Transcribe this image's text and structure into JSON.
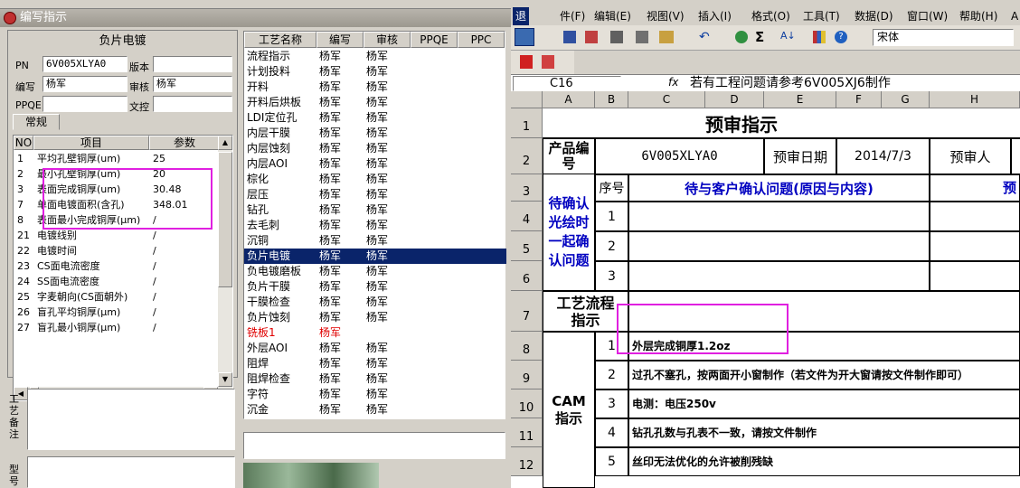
{
  "left_window": {
    "title": "编写指示"
  },
  "product_panel": {
    "header": "负片电镀",
    "pn_label": "PN",
    "pn_value": "6V005XLYA0",
    "version_label": "版本",
    "version_value": "",
    "writer_label": "编写",
    "writer_value": "杨军",
    "reviewer_label": "审核",
    "reviewer_value": "杨军",
    "ppqe_label": "PPQE",
    "ppqe_value": "",
    "doc_hole_label": "文控",
    "doc_hole_value": "",
    "tab_general": "常规"
  },
  "param_grid": {
    "headers": [
      "NO",
      "项目",
      "参数"
    ],
    "rows": [
      {
        "no": "1",
        "item": "平均孔壁铜厚(um)",
        "value": "25"
      },
      {
        "no": "2",
        "item": "最小孔壁铜厚(um)",
        "value": "20"
      },
      {
        "no": "3",
        "item": "表面完成铜厚(um)",
        "value": "30.48"
      },
      {
        "no": "7",
        "item": "单面电镀面积(含孔)",
        "value": "348.01"
      },
      {
        "no": "8",
        "item": "表面最小完成铜厚(μm)",
        "value": "/"
      },
      {
        "no": "21",
        "item": "电镀线别",
        "value": "/"
      },
      {
        "no": "22",
        "item": "电镀时间",
        "value": "/"
      },
      {
        "no": "23",
        "item": "CS面电流密度",
        "value": "/"
      },
      {
        "no": "24",
        "item": "SS面电流密度",
        "value": "/"
      },
      {
        "no": "25",
        "item": "字麦朝向(CS面朝外)",
        "value": "/"
      },
      {
        "no": "26",
        "item": "盲孔平均铜厚(μm)",
        "value": "/"
      },
      {
        "no": "27",
        "item": "盲孔最小铜厚(μm)",
        "value": "/"
      }
    ]
  },
  "notes": {
    "label1": "工艺备注",
    "label2": "型号"
  },
  "process_grid": {
    "headers": [
      "工艺名称",
      "编写",
      "审核",
      "PPQE",
      "PPC"
    ],
    "rows": [
      {
        "name": "流程指示",
        "writer": "杨军",
        "reviewer": "杨军"
      },
      {
        "name": "计划投料",
        "writer": "杨军",
        "reviewer": "杨军"
      },
      {
        "name": "开料",
        "writer": "杨军",
        "reviewer": "杨军"
      },
      {
        "name": "开料后烘板",
        "writer": "杨军",
        "reviewer": "杨军"
      },
      {
        "name": "LDI定位孔",
        "writer": "杨军",
        "reviewer": "杨军"
      },
      {
        "name": "内层干膜",
        "writer": "杨军",
        "reviewer": "杨军"
      },
      {
        "name": "内层蚀刻",
        "writer": "杨军",
        "reviewer": "杨军"
      },
      {
        "name": "内层AOI",
        "writer": "杨军",
        "reviewer": "杨军"
      },
      {
        "name": "棕化",
        "writer": "杨军",
        "reviewer": "杨军"
      },
      {
        "name": "层压",
        "writer": "杨军",
        "reviewer": "杨军"
      },
      {
        "name": "钻孔",
        "writer": "杨军",
        "reviewer": "杨军"
      },
      {
        "name": "去毛刺",
        "writer": "杨军",
        "reviewer": "杨军"
      },
      {
        "name": "沉铜",
        "writer": "杨军",
        "reviewer": "杨军"
      },
      {
        "name": "负片电镀",
        "writer": "杨军",
        "reviewer": "杨军"
      },
      {
        "name": "负电镀磨板",
        "writer": "杨军",
        "reviewer": "杨军"
      },
      {
        "name": "负片干膜",
        "writer": "杨军",
        "reviewer": "杨军"
      },
      {
        "name": "干膜检查",
        "writer": "杨军",
        "reviewer": "杨军"
      },
      {
        "name": "负片蚀刻",
        "writer": "杨军",
        "reviewer": "杨军"
      },
      {
        "name": "铣板1",
        "writer": "杨军",
        "reviewer": ""
      },
      {
        "name": "外层AOI",
        "writer": "杨军",
        "reviewer": "杨军"
      },
      {
        "name": "阻焊",
        "writer": "杨军",
        "reviewer": "杨军"
      },
      {
        "name": "阻焊检查",
        "writer": "杨军",
        "reviewer": "杨军"
      },
      {
        "name": "字符",
        "writer": "杨军",
        "reviewer": "杨军"
      },
      {
        "name": "沉金",
        "writer": "杨军",
        "reviewer": "杨军"
      }
    ]
  },
  "excel": {
    "menu": [
      "退",
      "件(F)",
      "编辑(E)",
      "视图(V)",
      "插入(I)",
      "格式(O)",
      "工具(T)",
      "数据(D)",
      "窗口(W)",
      "帮助(H)",
      "A"
    ],
    "font_name": "宋体",
    "cell_ref": "C16",
    "fx": "fx",
    "formula": "若有工程问题请参考6V005XJ6制作",
    "columns": [
      "A",
      "B",
      "C",
      "D",
      "E",
      "F",
      "G",
      "H"
    ],
    "row_numbers": [
      "1",
      "2",
      "3",
      "4",
      "5",
      "6",
      "7",
      "8",
      "9",
      "10",
      "11",
      "12"
    ],
    "title": "预审指示",
    "product_label": "产品编号",
    "product_no": "6V005XLYA0",
    "review_date_label": "预审日期",
    "review_date": "2014/7/3",
    "reviewer_label": "预审人",
    "seq_label": "序号",
    "issues_label": "待与客户确认问题(原因与内容)",
    "pre_label": "预",
    "pending_label": "待确认光绘时一起确认问题",
    "pending_rows": [
      "1",
      "2",
      "3"
    ],
    "process_label": "工艺流程指示",
    "cam_label": "CAM指示",
    "cam_items": [
      {
        "no": "1",
        "text": "外层完成铜厚1.2oz"
      },
      {
        "no": "2",
        "text": "过孔不塞孔，按两面开小窗制作（若文件为开大窗请按文件制作即可）"
      },
      {
        "no": "3",
        "text": "电测：电压250v"
      },
      {
        "no": "4",
        "text": "钻孔孔数与孔表不一致，请按文件制作"
      },
      {
        "no": "5",
        "text": "丝印无法优化的允许被削残缺"
      }
    ]
  },
  "colors": {
    "highlight": "#e020e0",
    "selection": "#0a246a",
    "excel_blue": "#0000c0"
  }
}
